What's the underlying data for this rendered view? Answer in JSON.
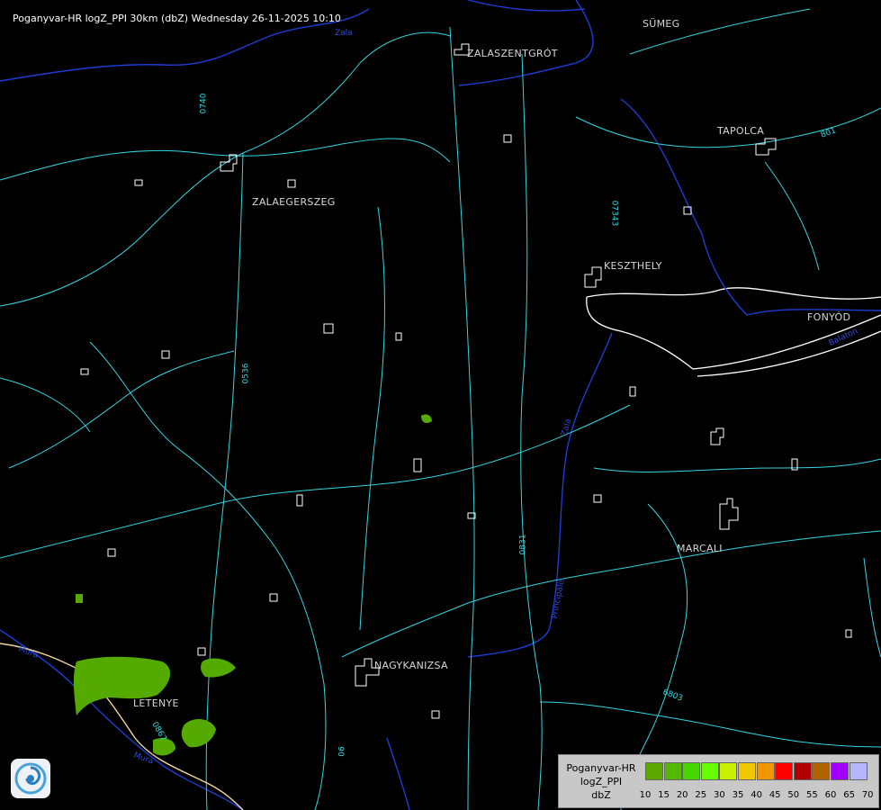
{
  "title": "Poganyvar-HR logZ_PPI 30km (dbZ) Wednesday 26-11-2025 10:10",
  "towns": {
    "sumeg": "SÜMEG",
    "zalaszentgrot": "ZALASZENTGRÓT",
    "tapolca": "TAPOLCA",
    "zalaegerszeg": "ZALAEGERSZEG",
    "keszthely": "KESZTHELY",
    "fonyod": "FONYÓD",
    "marcali": "MARCALI",
    "nagykanizsa": "NAGYKANIZSA",
    "letenye": "LETENYE"
  },
  "roads": {
    "r0740": "0740",
    "r07343": "07343",
    "r0536": "0536",
    "r0831": "0831",
    "r6803": "6803",
    "r0867": "0867",
    "r06": "06",
    "r801": "801"
  },
  "waters": {
    "zala": "Zala",
    "zala2": "Zala",
    "balaton": "Balaton",
    "mura": "Mura",
    "principalis": "Principális",
    "mura2": "Mura"
  },
  "legend": {
    "label_lines": [
      "Poganyvar-HR",
      "logZ_PPI",
      "dbZ"
    ],
    "levels": [
      "10",
      "15",
      "20",
      "25",
      "30",
      "35",
      "40",
      "45",
      "50",
      "55",
      "60",
      "65",
      "70"
    ],
    "colors": [
      "#5ca800",
      "#52b800",
      "#46d600",
      "#66ff00",
      "#c8f000",
      "#f0c800",
      "#f09600",
      "#ff0000",
      "#b00000",
      "#b06400",
      "#a000ff",
      "#b4b4ff"
    ]
  },
  "colors": {
    "background": "#000000",
    "road": "#33d6e0",
    "settlement": "#ffffff",
    "water": "#1e3cd2",
    "border": "#f5d8a0",
    "echo": "#55aa00"
  }
}
